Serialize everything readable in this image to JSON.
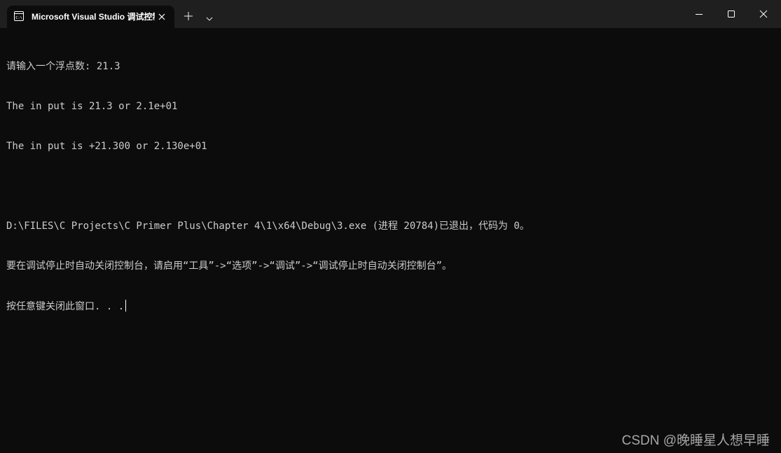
{
  "window": {
    "tab_title": "Microsoft Visual Studio 调试控制台",
    "tab_icon": "terminal-icon",
    "new_tab_icon": "plus-icon",
    "dropdown_icon": "chevron-down-icon",
    "minimize_icon": "minimize-icon",
    "maximize_icon": "maximize-icon",
    "close_icon": "close-icon"
  },
  "console": {
    "lines": [
      "请输入一个浮点数: 21.3",
      "The in put is 21.3 or 2.1e+01",
      "The in put is +21.300 or 2.130e+01",
      "",
      "D:\\FILES\\C Projects\\C Primer Plus\\Chapter 4\\1\\x64\\Debug\\3.exe (进程 20784)已退出，代码为 0。",
      "要在调试停止时自动关闭控制台，请启用“工具”->“选项”->“调试”->“调试停止时自动关闭控制台”。",
      "按任意键关闭此窗口. . ."
    ]
  },
  "watermark": "CSDN @晚睡星人想早睡",
  "colors": {
    "background": "#0c0c0c",
    "titlebar": "#1f1f1f",
    "text": "#cccccc"
  }
}
